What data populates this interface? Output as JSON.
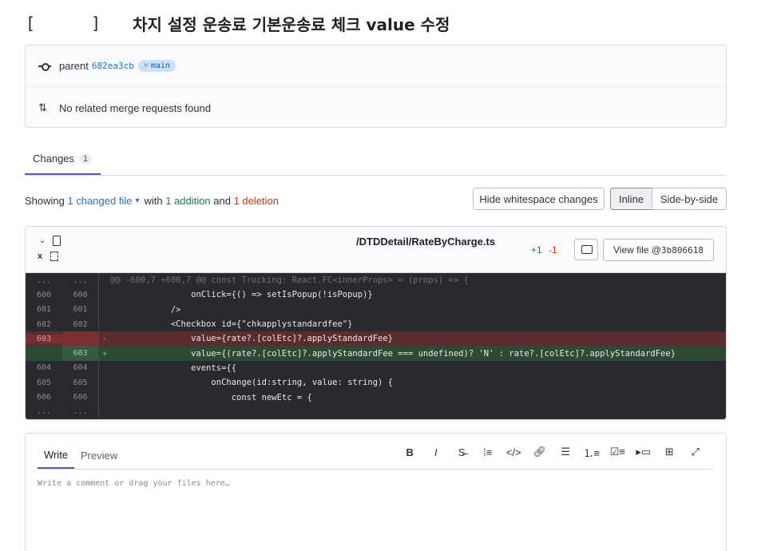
{
  "commit": {
    "title_open": "[",
    "title_close": "]",
    "title_text": "차지 설정 운송료 기본운송료 체크 value 수정",
    "parent_label": "parent",
    "parent_sha": "682ea3cb",
    "branch": "main",
    "merge_requests": "No related merge requests found"
  },
  "tabs": [
    {
      "label": "Changes",
      "count": "1"
    }
  ],
  "summary": {
    "showing": "Showing",
    "changed_files": "1 changed file",
    "with": "with",
    "additions": "1 addition",
    "and": "and",
    "deletions": "1 deletion"
  },
  "toolbar": {
    "hide_whitespace": "Hide whitespace changes",
    "inline": "Inline",
    "side_by_side": "Side-by-side"
  },
  "file": {
    "path": "/DTDDetail/RateByCharge.ts",
    "added": "+1",
    "deleted": "-1",
    "view_file_label": "View file @",
    "view_file_sha": "3b806618",
    "close_glyph": "x"
  },
  "diff_lines": [
    {
      "type": "hunk",
      "old": "...",
      "new": "...",
      "text": "@@ -600,7 +600,7 @@ const Trucking: React.FC<innerProps> = (props) => {"
    },
    {
      "type": "ctx",
      "old": "600",
      "new": "600",
      "text": "                onClick={() => setIsPopup(!isPopup)}"
    },
    {
      "type": "ctx",
      "old": "601",
      "new": "601",
      "text": "            />"
    },
    {
      "type": "ctx",
      "old": "602",
      "new": "602",
      "text": "            <Checkbox id={\"chkapplystandardfee\"}"
    },
    {
      "type": "del",
      "old": "603",
      "new": "",
      "text": "                value={rate?.[colEtc]?.applyStandardFee}"
    },
    {
      "type": "add",
      "old": "",
      "new": "603",
      "text": "                value={(rate?.[colEtc]?.applyStandardFee === undefined)? 'N' : rate?.[colEtc]?.applyStandardFee}"
    },
    {
      "type": "ctx",
      "old": "604",
      "new": "604",
      "text": "                events={{"
    },
    {
      "type": "ctx",
      "old": "605",
      "new": "605",
      "text": "                    onChange(id:string, value: string) {"
    },
    {
      "type": "ctx",
      "old": "606",
      "new": "606",
      "text": "                        const newEtc = {"
    },
    {
      "type": "hunk",
      "old": "...",
      "new": "...",
      "text": ""
    }
  ],
  "editor": {
    "write_tab": "Write",
    "preview_tab": "Preview",
    "placeholder": "Write a comment or drag your files here…",
    "tools": [
      {
        "name": "bold-icon",
        "glyph": "B"
      },
      {
        "name": "italic-icon",
        "glyph": "I"
      },
      {
        "name": "strikethrough-icon",
        "glyph": "S̶"
      },
      {
        "name": "quote-icon",
        "glyph": "⁞≡"
      },
      {
        "name": "code-icon",
        "glyph": "</>"
      },
      {
        "name": "link-icon",
        "glyph": "🔗︎"
      },
      {
        "name": "bullet-list-icon",
        "glyph": "☰"
      },
      {
        "name": "numbered-list-icon",
        "glyph": "⒈≡"
      },
      {
        "name": "task-list-icon",
        "glyph": "☑≡"
      },
      {
        "name": "collapsible-icon",
        "glyph": "▸▭"
      },
      {
        "name": "table-icon",
        "glyph": "⊞"
      },
      {
        "name": "fullscreen-icon",
        "glyph": "⤢"
      }
    ]
  }
}
